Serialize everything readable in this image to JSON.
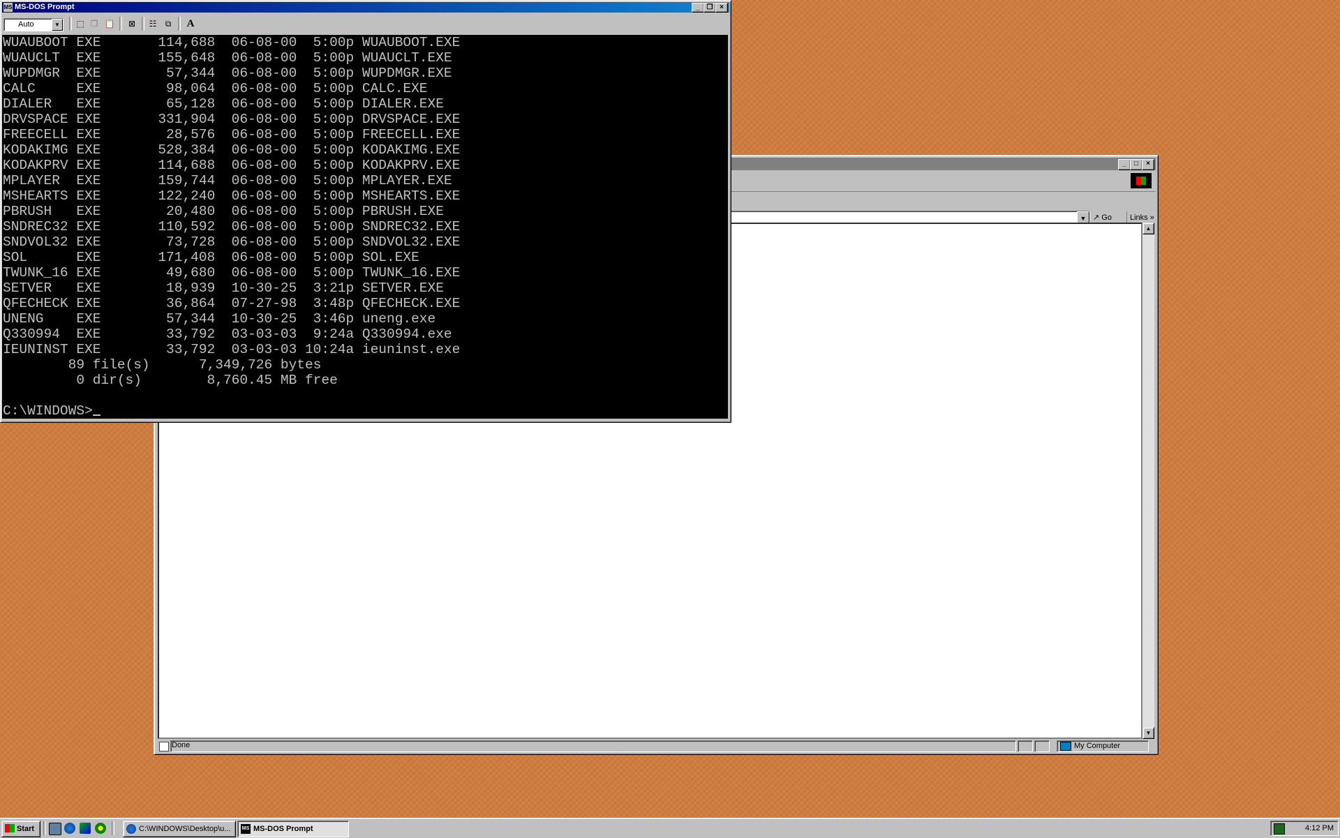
{
  "dos": {
    "title": "MS-DOS Prompt",
    "font_size": "Auto",
    "console_lines": [
      "WUAUBOOT EXE       114,688  06-08-00  5:00p WUAUBOOT.EXE",
      "WUAUCLT  EXE       155,648  06-08-00  5:00p WUAUCLT.EXE",
      "WUPDMGR  EXE        57,344  06-08-00  5:00p WUPDMGR.EXE",
      "CALC     EXE        98,064  06-08-00  5:00p CALC.EXE",
      "DIALER   EXE        65,128  06-08-00  5:00p DIALER.EXE",
      "DRVSPACE EXE       331,904  06-08-00  5:00p DRVSPACE.EXE",
      "FREECELL EXE        28,576  06-08-00  5:00p FREECELL.EXE",
      "KODAKIMG EXE       528,384  06-08-00  5:00p KODAKIMG.EXE",
      "KODAKPRV EXE       114,688  06-08-00  5:00p KODAKPRV.EXE",
      "MPLAYER  EXE       159,744  06-08-00  5:00p MPLAYER.EXE",
      "MSHEARTS EXE       122,240  06-08-00  5:00p MSHEARTS.EXE",
      "PBRUSH   EXE        20,480  06-08-00  5:00p PBRUSH.EXE",
      "SNDREC32 EXE       110,592  06-08-00  5:00p SNDREC32.EXE",
      "SNDVOL32 EXE        73,728  06-08-00  5:00p SNDVOL32.EXE",
      "SOL      EXE       171,408  06-08-00  5:00p SOL.EXE",
      "TWUNK_16 EXE        49,680  06-08-00  5:00p TWUNK_16.EXE",
      "SETVER   EXE        18,939  10-30-25  3:21p SETVER.EXE",
      "QFECHECK EXE        36,864  07-27-98  3:48p QFECHECK.EXE",
      "UNENG    EXE        57,344  10-30-25  3:46p uneng.exe",
      "Q330994  EXE        33,792  03-03-03  9:24a Q330994.exe",
      "IEUNINST EXE        33,792  03-03-03 10:24a ieuninst.exe",
      "        89 file(s)      7,349,726 bytes",
      "         0 dir(s)        8,760.45 MB free",
      ""
    ],
    "prompt": "C:\\WINDOWS>"
  },
  "ie": {
    "go_label": "Go",
    "links_label": "Links",
    "links_chevron": "»",
    "status_text": "Done",
    "zone_text": "My Computer"
  },
  "taskbar": {
    "start_label": "Start",
    "tasks": [
      {
        "label": "C:\\WINDOWS\\Desktop\\u..."
      },
      {
        "label": "MS-DOS Prompt"
      }
    ],
    "clock": "4:12 PM"
  }
}
